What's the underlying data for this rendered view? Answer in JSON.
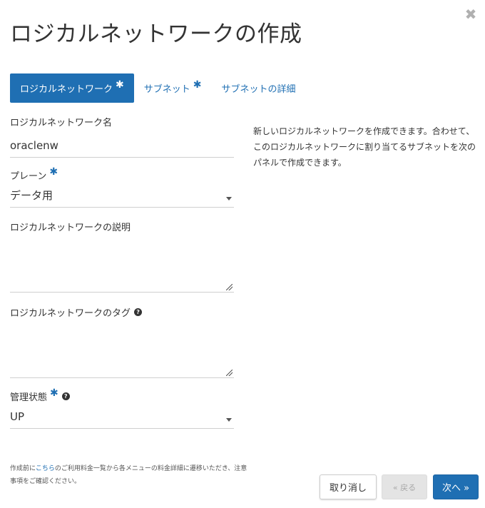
{
  "dialog": {
    "title": "ロジカルネットワークの作成",
    "close_glyph": "✖"
  },
  "tabs": [
    {
      "label": "ロジカルネットワーク",
      "required": true,
      "active": true
    },
    {
      "label": "サブネット",
      "required": true,
      "active": false
    },
    {
      "label": "サブネットの詳細",
      "required": false,
      "active": false
    }
  ],
  "required_mark": "✱",
  "help_glyph": "?",
  "form": {
    "name": {
      "label": "ロジカルネットワーク名",
      "value": "oraclenw"
    },
    "plane": {
      "label": "プレーン",
      "value": "データ用"
    },
    "description": {
      "label": "ロジカルネットワークの説明",
      "value": ""
    },
    "tags": {
      "label": "ロジカルネットワークのタグ",
      "value": ""
    },
    "admin_state": {
      "label": "管理状態",
      "value": "UP"
    }
  },
  "help_text": "新しいロジカルネットワークを作成できます。合わせて、このロジカルネットワークに割り当てるサブネットを次のパネルで作成できます。",
  "footnote": {
    "prefix": "作成前に",
    "link": "こちら",
    "suffix": "のご利用料金一覧から各メニューの料金詳細に遷移いただき、注意事項をご確認ください。"
  },
  "buttons": {
    "cancel": "取り消し",
    "back": "« 戻る",
    "next": "次へ »"
  },
  "colors": {
    "accent": "#1f6fb3"
  }
}
